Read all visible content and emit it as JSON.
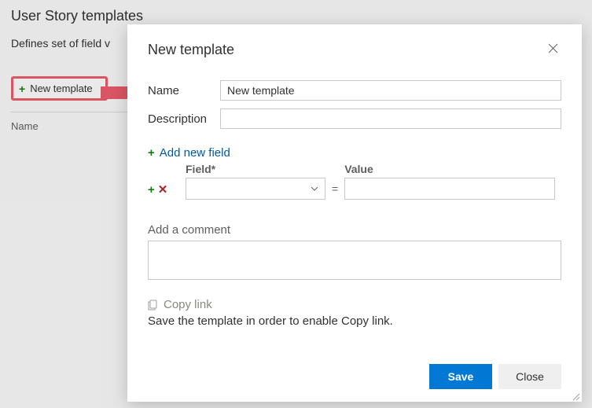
{
  "background": {
    "title": "User Story templates",
    "description": "Defines set of field v",
    "new_template_button": "New template",
    "name_column": "Name"
  },
  "dialog": {
    "title": "New template",
    "close_label": "Close dialog",
    "form": {
      "name_label": "Name",
      "name_value": "New template",
      "description_label": "Description",
      "description_value": ""
    },
    "add_field": {
      "link_label": "Add new field",
      "field_header": "Field*",
      "value_header": "Value",
      "equals": "=",
      "field_value": "",
      "value_value": ""
    },
    "comment": {
      "label": "Add a comment",
      "value": ""
    },
    "copy": {
      "link_label": "Copy link",
      "description": "Save the template in order to enable Copy link."
    },
    "footer": {
      "save": "Save",
      "close": "Close"
    }
  }
}
